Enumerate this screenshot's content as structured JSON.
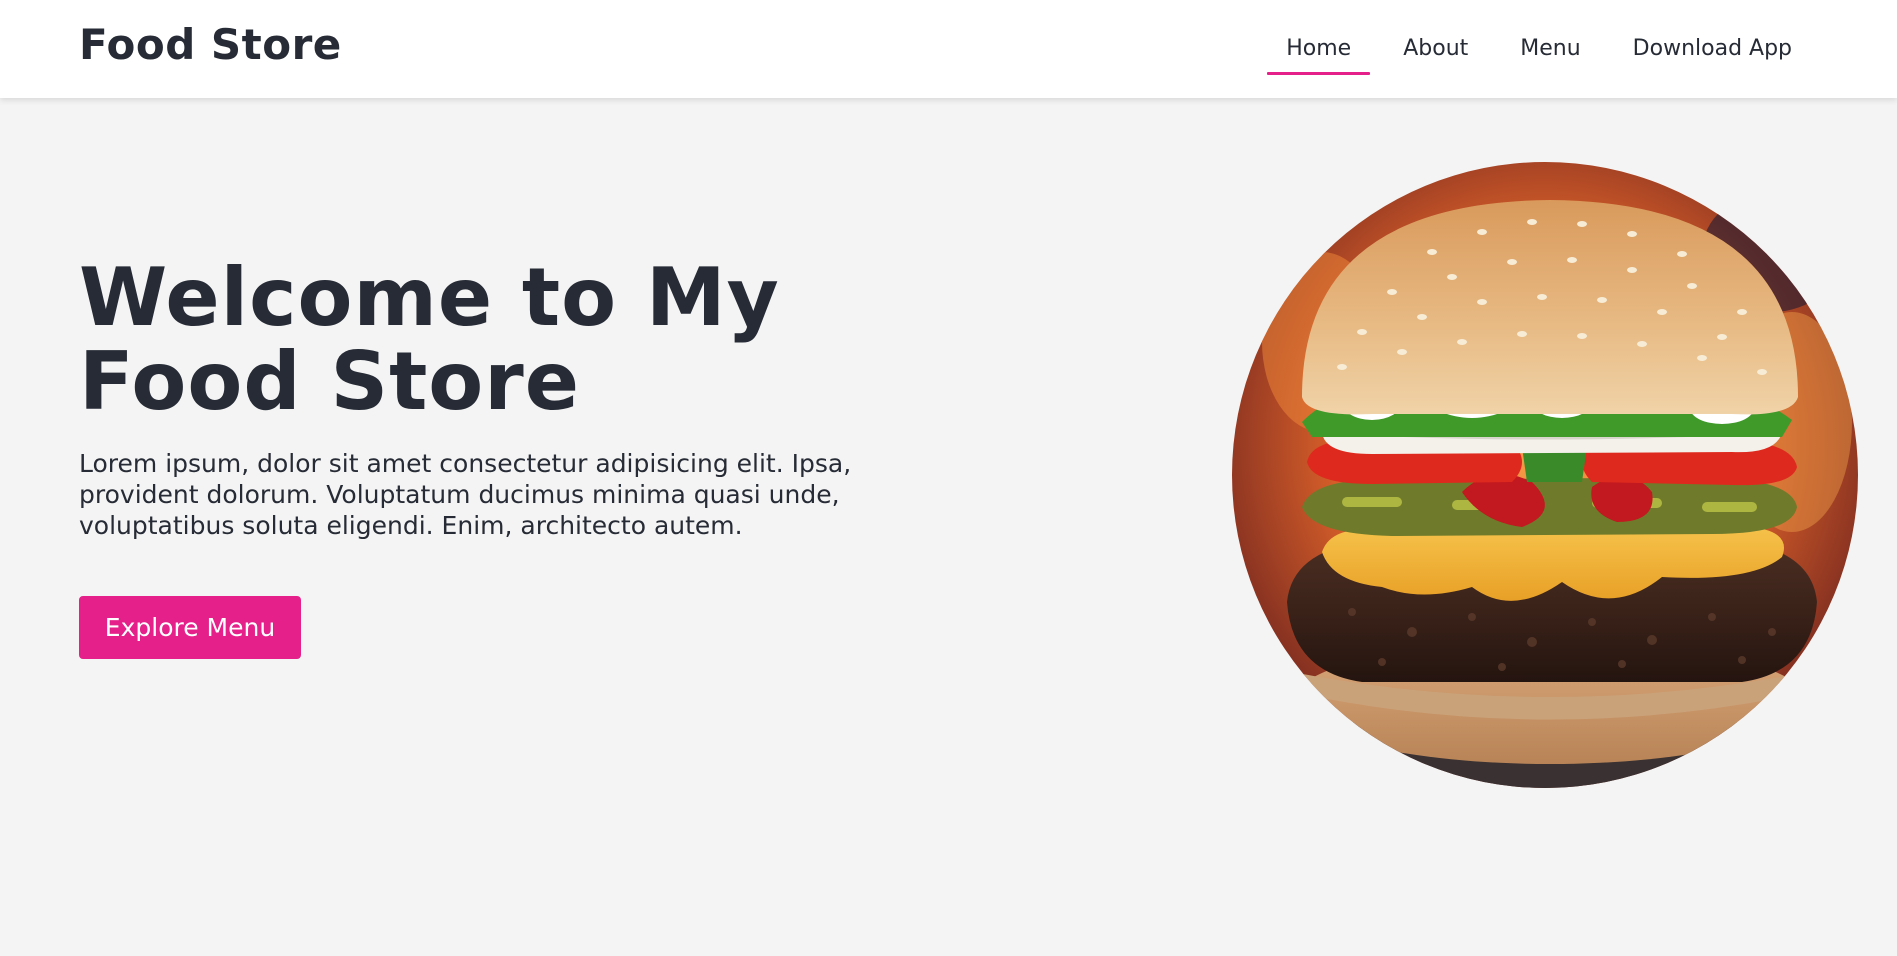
{
  "header": {
    "logo": "Food Store",
    "nav": [
      {
        "label": "Home",
        "active": true
      },
      {
        "label": "About",
        "active": false
      },
      {
        "label": "Menu",
        "active": false
      },
      {
        "label": "Download App",
        "active": false
      }
    ]
  },
  "hero": {
    "title": "Welcome to My Food Store",
    "text": "Lorem ipsum, dolor sit amet consectetur adipisicing elit. Ipsa, provident dolorum. Voluptatum ducimus minima quasi unde, voluptatibus soluta eligendi. Enim, architecto autem.",
    "cta_label": "Explore Menu",
    "image": "burger-photo"
  },
  "colors": {
    "accent": "#e5208a",
    "text": "#262b35",
    "background": "#f4f4f4",
    "header_bg": "#ffffff"
  }
}
